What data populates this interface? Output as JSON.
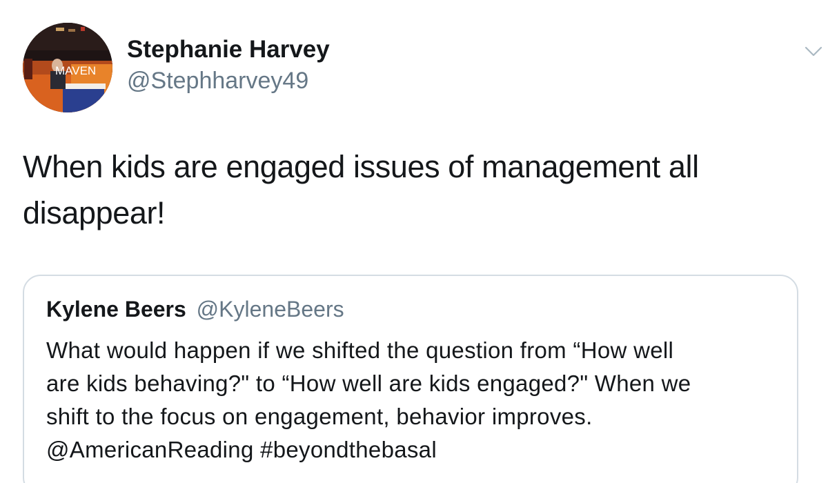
{
  "tweet": {
    "author_name": "Stephanie Harvey",
    "author_handle": "@Stephharvey49",
    "avatar_sign_text": "MAVEN",
    "text_line1": "When kids are engaged issues of management all",
    "text_line2": "disappear!"
  },
  "quoted_tweet": {
    "author_name": "Kylene Beers",
    "author_handle": "@KyleneBeers",
    "text_line1": "What would happen if we shifted the question from “How well",
    "text_line2": "are kids behaving?\" to “How well are kids engaged?\" When we",
    "text_line3": "shift to the focus on engagement, behavior improves.",
    "text_line4": "@AmericanReading #beyondthebasal"
  },
  "icons": {
    "menu": "chevron-down-icon"
  },
  "colors": {
    "text_primary": "#14171a",
    "text_secondary": "#657786",
    "quote_border": "#d4dce3",
    "chevron": "#aab8c2"
  }
}
